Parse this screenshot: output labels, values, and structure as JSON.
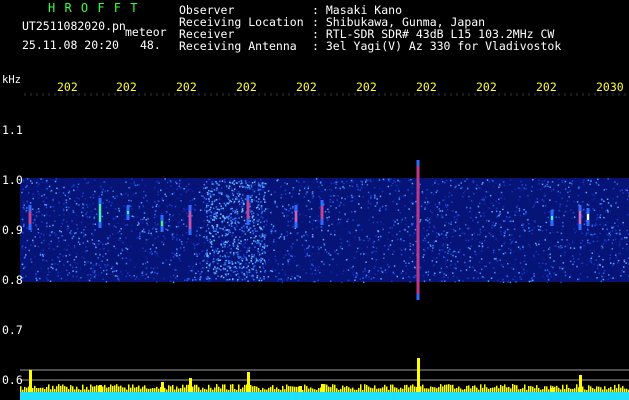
{
  "header": {
    "logo": "H R O F F T",
    "filename": "UT2511082020.pn",
    "mode": "meteor",
    "datetime": "25.11.08 20:20",
    "count": "48.",
    "labels": [
      "Observer",
      "Receiving Location",
      "Receiver",
      "Receiving Antenna"
    ],
    "values": [
      ": Masaki Kano",
      ": Shibukawa, Gunma, Japan",
      ": RTL-SDR SDR# 43dB L15 103.2MHz CW",
      ": 3el Yagi(V) Az 330 for Vladivostok"
    ]
  },
  "axis": {
    "unit": "kHz",
    "y_ticks": [
      "1.1",
      "1.0",
      "0.9",
      "0.8",
      "0.7",
      "0.6"
    ],
    "time_labels": [
      "202",
      "202",
      "202",
      "202",
      "202",
      "202",
      "202",
      "202",
      "202",
      "2030"
    ]
  },
  "colors": {
    "background": "#000000",
    "text_header": "#ffffff",
    "logo": "#39ff39",
    "time_labels": "#ffff33",
    "band_base": "#0a1fa8",
    "power_bar": "#ffff00",
    "floor": "#20e0ff"
  }
}
